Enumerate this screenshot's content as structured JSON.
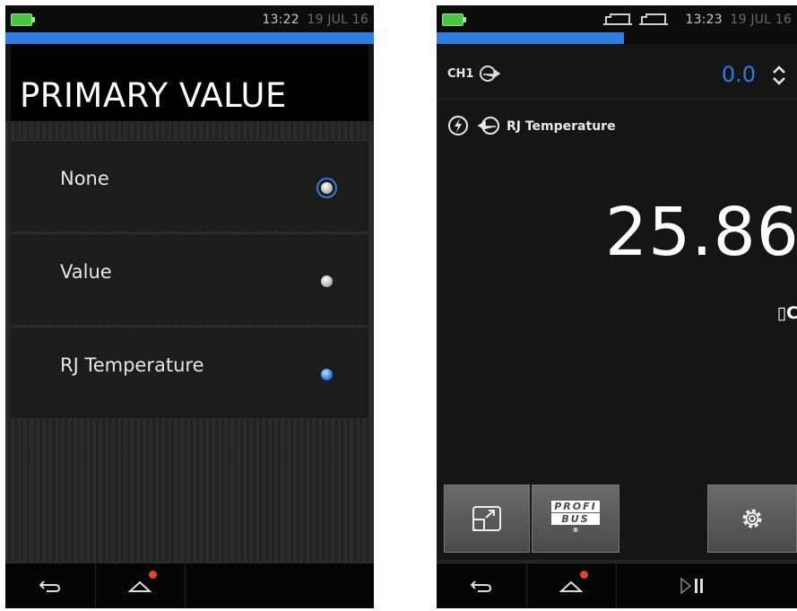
{
  "left_screen": {
    "status": {
      "time": "13:22",
      "date": "19 JUL 16"
    },
    "title": "PRIMARY VALUE",
    "options": [
      {
        "label": "None",
        "state": "focused"
      },
      {
        "label": "Value",
        "state": "unselected"
      },
      {
        "label": "RJ Temperature",
        "state": "selected"
      }
    ],
    "progress_fraction": 1.0
  },
  "right_screen": {
    "status": {
      "time": "13:23",
      "date": "19 JUL 16"
    },
    "progress_fraction": 0.52,
    "channel": {
      "label": "CH1",
      "value": "0.0"
    },
    "sensor": {
      "label": "RJ Temperature"
    },
    "reading": {
      "value": "25.86",
      "unit": "▯C"
    },
    "buttons": {
      "profibus_top": "PROFI",
      "profibus_bottom": "BUS",
      "profibus_mark": "®"
    }
  },
  "colors": {
    "accent": "#2f7de0",
    "battery": "#48c43f",
    "alert_dot": "#e0442a"
  },
  "icons": [
    "battery-icon",
    "usb-icon",
    "back-icon",
    "home-icon",
    "play-pause-icon",
    "settings-icon",
    "expand-icon",
    "lightning-icon",
    "arrow-right-icon",
    "arrow-left-icon",
    "up-down-icon"
  ]
}
